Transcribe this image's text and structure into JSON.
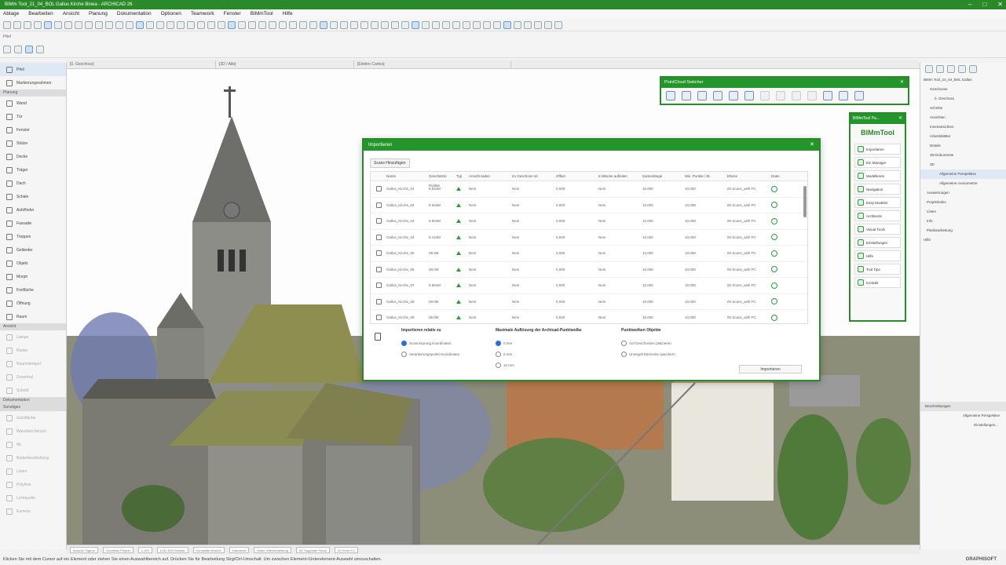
{
  "window": {
    "title": "BIMm Tool_21_04_BOL Gallus Kirche Binea - ARCHICAD 26"
  },
  "menu": [
    "Ablage",
    "Bearbeiten",
    "Ansicht",
    "Planung",
    "Dokumentation",
    "Optionen",
    "Teamwork",
    "Fenster",
    "BIMmTool",
    "Hilfe"
  ],
  "subbar": {
    "label": "Pfeil"
  },
  "view_tabs": [
    "[0. Geschoss]",
    "[3D / Alle]",
    "[Elektro Cartes]"
  ],
  "left_panel": {
    "top_items": [
      {
        "label": "Pfeil"
      },
      {
        "label": "Markierungsrahmen"
      }
    ],
    "sections": [
      {
        "title": "Planung",
        "items": [
          "Wand",
          "Tür",
          "Fenster",
          "Stütze",
          "Decke",
          "Träger",
          "Dach",
          "Schale",
          "Aufzfinder",
          "Fassade",
          "Treppen",
          "Geländer",
          "Objekt",
          "Morph",
          "Freifläche",
          "Öffnung",
          "Raum"
        ],
        "dim": false
      },
      {
        "title": "Ansicht",
        "items": [
          "Lampe",
          "Raster",
          "Raumstempel",
          "Zonenhal",
          "Schnitt"
        ],
        "dim": true
      },
      {
        "title": "Dokumentation",
        "items": [],
        "dim": false
      },
      {
        "title": "Sonstiges",
        "items": [
          "Grünfläche",
          "Wanddurchbruch",
          "Mt.",
          "Bodenbearbeitung",
          "Linien",
          "Polylinie",
          "Lichtquelle",
          "Kamera"
        ],
        "dim": true
      }
    ]
  },
  "right_panel": {
    "tree": [
      "BIMm Tool_21_04_BOL Gallus",
      "Geschosse",
      "0. Geschoss",
      "Schnitte",
      "Ansichten",
      "Innenansichten",
      "Arbeitsblätter",
      "Details",
      "3D-Dokumente",
      "3D",
      "Allgemeine Perspektive",
      "Allgemeine Axonometrie",
      "Auswertungen",
      "Projektindex",
      "Listen",
      "Info",
      "Planbearbeitung",
      "Hilfe"
    ],
    "props_label": "Beschreibungen",
    "props_value": "Allgemeine Perspektive",
    "settings_label": "Einstellungen..."
  },
  "import_dialog": {
    "title": "Importieren",
    "add_scans_label": "Scans Hinzufügen",
    "columns": [
      "Name",
      "Geschätzte Punkte",
      "Typ",
      "Ansicht laden",
      "Im Geschoss rel.",
      "Offset",
      "In Blöcke aufteilen",
      "Kantenlänge",
      "Min. Punkte / Bl.",
      "Ebene",
      "Datei"
    ],
    "rows": [
      {
        "name": "Gallus_Kirche_01",
        "points": "9.534M",
        "view": "Nein",
        "geschoss": "Nein",
        "offset": "0,000",
        "bloecke": "Nein",
        "kante": "10,000",
        "minpunkte": "10,000",
        "ebene": "00 Scans_with PC"
      },
      {
        "name": "Gallus_Kirche_02",
        "points": "9.534M",
        "view": "Nein",
        "geschoss": "Nein",
        "offset": "0,000",
        "bloecke": "Nein",
        "kante": "10,000",
        "minpunkte": "10,000",
        "ebene": "00 Scans_with PC"
      },
      {
        "name": "Gallus_Kirche_03",
        "points": "9.804M",
        "view": "Nein",
        "geschoss": "Nein",
        "offset": "0,000",
        "bloecke": "Nein",
        "kante": "10,000",
        "minpunkte": "10,000",
        "ebene": "00 Scans_with PC"
      },
      {
        "name": "Gallus_Kirche_04",
        "points": "9.414M",
        "view": "Nein",
        "geschoss": "Nein",
        "offset": "0,000",
        "bloecke": "Nein",
        "kante": "10,000",
        "minpunkte": "10,000",
        "ebene": "00 Scans_with PC"
      },
      {
        "name": "Gallus_Kirche_05",
        "points": "09.3M",
        "view": "Nein",
        "geschoss": "Nein",
        "offset": "0,000",
        "bloecke": "Nein",
        "kante": "10,000",
        "minpunkte": "10,000",
        "ebene": "00 Scans_with PC"
      },
      {
        "name": "Gallus_Kirche_06",
        "points": "08.0M",
        "view": "Nein",
        "geschoss": "Nein",
        "offset": "0,000",
        "bloecke": "Nein",
        "kante": "10,000",
        "minpunkte": "10,000",
        "ebene": "00 Scans_with PC"
      },
      {
        "name": "Gallus_Kirche_07",
        "points": "9.861M",
        "view": "Nein",
        "geschoss": "Nein",
        "offset": "0,000",
        "bloecke": "Nein",
        "kante": "10,000",
        "minpunkte": "10,000",
        "ebene": "00 Scans_with PC"
      },
      {
        "name": "Gallus_Kirche_08",
        "points": "09.0M",
        "view": "Nein",
        "geschoss": "Nein",
        "offset": "0,000",
        "bloecke": "Nein",
        "kante": "10,000",
        "minpunkte": "10,000",
        "ebene": "00 Scans_with PC"
      },
      {
        "name": "Gallus_Kirche_09",
        "points": "09.0M",
        "view": "Nein",
        "geschoss": "Nein",
        "offset": "0,000",
        "bloecke": "Nein",
        "kante": "10,000",
        "minpunkte": "10,000",
        "ebene": "00 Scans_with PC"
      }
    ],
    "group1": {
      "title": "Importieren relativ zu",
      "options": [
        "Scanursprung Koordinaten",
        "Verankerungspunkt Koordinaten"
      ],
      "selected": 0
    },
    "group2": {
      "title": "Maximale Auflösung der Archicad-Punktwolke",
      "options": [
        "0 mm",
        "5 mm",
        "10 mm"
      ],
      "selected": 0
    },
    "group3": {
      "title": "Punktwolken Objekte",
      "options": [
        "Auf Geschossen platzieren",
        "Unsegelt Elemente speichern"
      ]
    },
    "import_button": "Importieren"
  },
  "pointcloud_panel": {
    "title": "PointCloud Switcher"
  },
  "bimmtool_panel": {
    "title": "BIMmTool Pa...",
    "logo": "BIMmTool",
    "items": [
      "Importieren",
      "Ein Manager",
      "Modellieren",
      "Navigation",
      "Easy Modeler",
      "Architecte",
      "Visual Tools",
      "Einstellungen",
      "Hilfe",
      "Tool Tips",
      "Kontakt"
    ]
  },
  "statusbar": [
    "Ansicht: Eigene",
    "Grundriss Projekt",
    "1:100",
    "LOD-300 Scheibe",
    "Komplette Ansicht",
    "Individuell",
    "Keine Überschreibung",
    "00 Tragender Stock",
    "00 Höhe 0.0"
  ],
  "hint": "Klicken Sie mit dem Cursor auf ein Element oder ziehen Sie einen Auswahlbereich auf. Drücken Sie für Bearbeitung Strg/Ctrl-Umschalt. Um zwischen Element-/Unterelement-Auswahl umzuschalten.",
  "brand": "GRAPHISOFT"
}
